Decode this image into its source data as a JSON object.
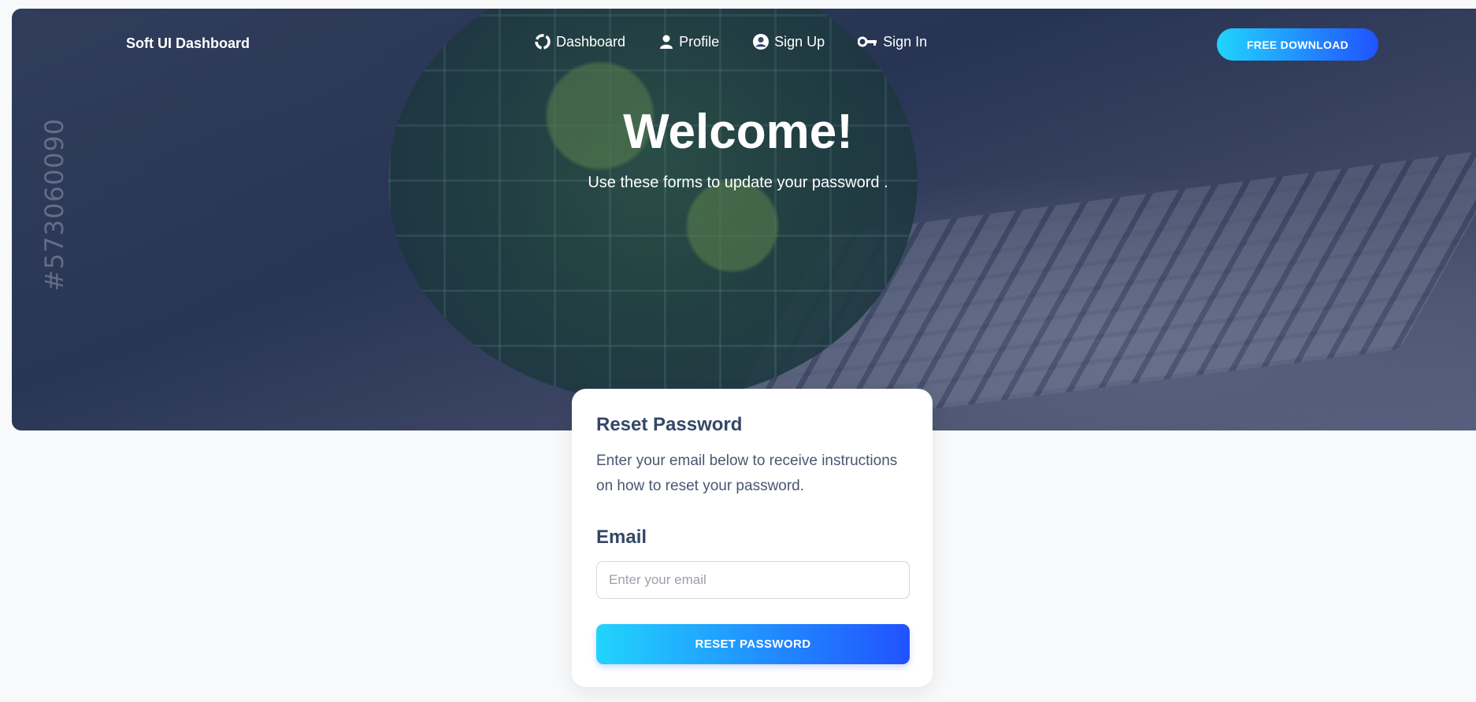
{
  "brand": "Soft UI Dashboard",
  "nav": [
    {
      "label": "Dashboard",
      "icon": "dashboard-icon"
    },
    {
      "label": "Profile",
      "icon": "user-icon"
    },
    {
      "label": "Sign Up",
      "icon": "user-circle-icon"
    },
    {
      "label": "Sign In",
      "icon": "key-icon"
    }
  ],
  "cta": "FREE DOWNLOAD",
  "hero": {
    "title": "Welcome!",
    "subtitle": "Use these forms to update your password .",
    "watermark": "#573060090"
  },
  "card": {
    "title": "Reset Password",
    "description": "Enter your email below to receive instructions on how to reset your password.",
    "email_label": "Email",
    "email_placeholder": "Enter your email",
    "email_value": "",
    "button": "RESET PASSWORD"
  },
  "colors": {
    "gradient_start": "#21d4fd",
    "gradient_end": "#2152ff",
    "heading": "#344767",
    "page_bg": "#f8f9fa"
  }
}
